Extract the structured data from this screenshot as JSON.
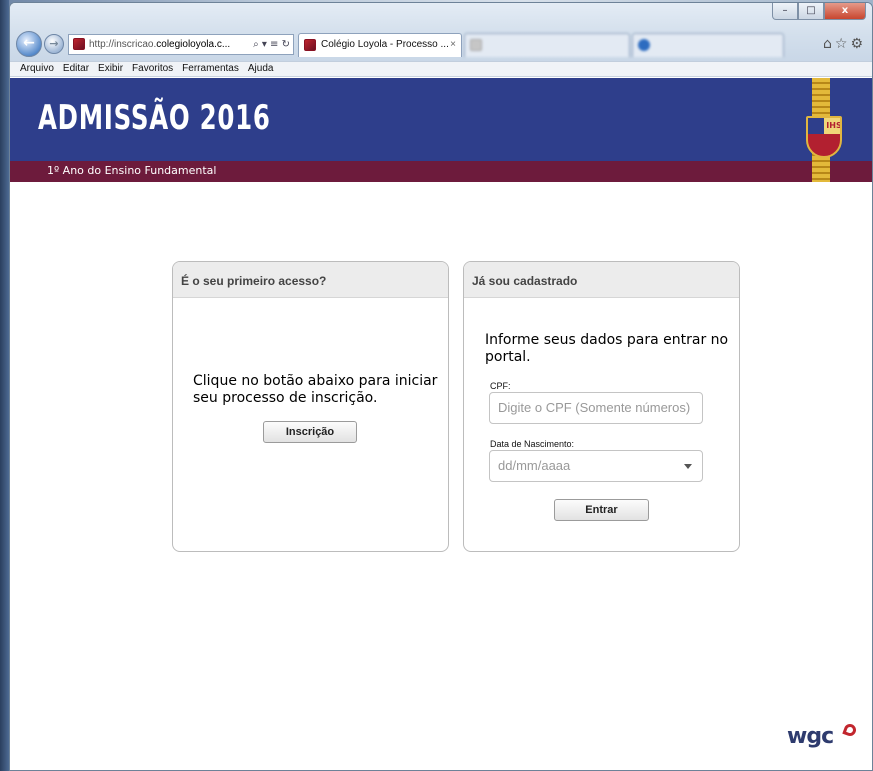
{
  "browser": {
    "address": {
      "prefix": "http://inscricao.",
      "domain": "colegioloyola.c...",
      "tools": "⌕ ▾ ≡ ↻"
    },
    "tabs": [
      {
        "title": "Colégio Loyola - Processo ...",
        "close": "×"
      }
    ],
    "window_buttons": {
      "minimize": "–",
      "maximize": "□",
      "close": "x"
    },
    "right_icons": "⌂☆⚙",
    "nav": {
      "back": "←",
      "forward": "→"
    },
    "menu": [
      "Arquivo",
      "Editar",
      "Exibir",
      "Favoritos",
      "Ferramentas",
      "Ajuda"
    ]
  },
  "header": {
    "title": "ADMISSÃO 2016",
    "subtitle": "1º Ano do Ensino Fundamental",
    "crest_text": "IHS"
  },
  "first_access": {
    "heading": "É o seu primeiro acesso?",
    "message": "Clique no botão abaixo para iniciar seu processo de inscrição.",
    "button": "Inscrição"
  },
  "registered": {
    "heading": "Já sou cadastrado",
    "message": "Informe seus dados para entrar no portal.",
    "cpf_label": "CPF:",
    "cpf_placeholder": "Digite o CPF (Somente números)",
    "birth_label": "Data de Nascimento:",
    "birth_placeholder": "dd/mm/aaaa",
    "button": "Entrar"
  },
  "footer": {
    "logo_text": "wgc"
  },
  "colors": {
    "banner": "#2e3e8b",
    "subbar": "#6d1b3c",
    "card_header": "#ececec"
  }
}
